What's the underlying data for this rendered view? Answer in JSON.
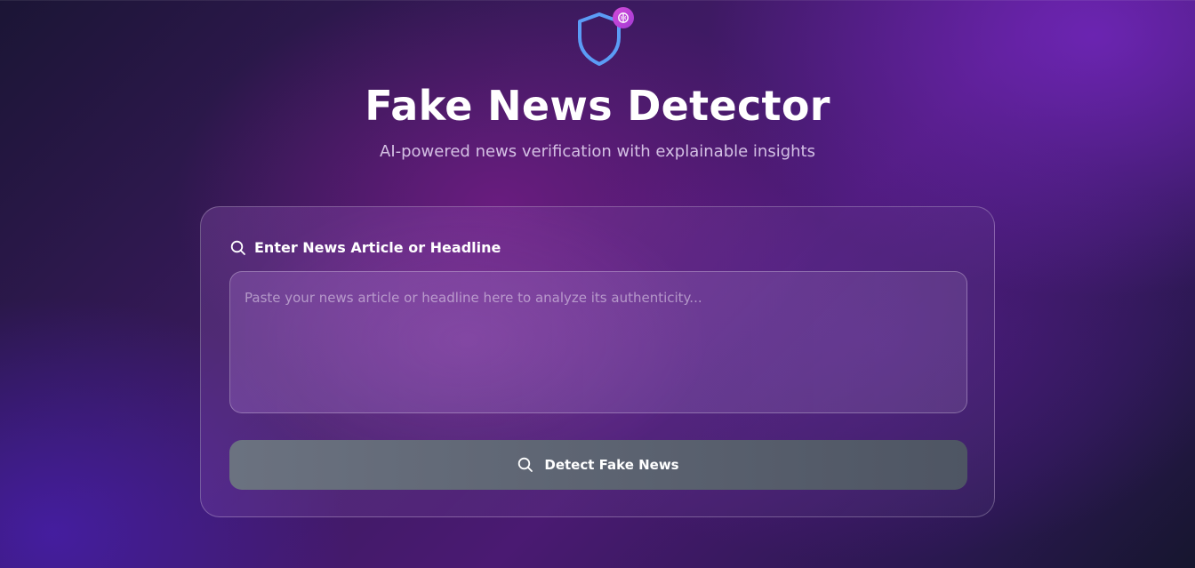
{
  "header": {
    "logo_icon": "shield-icon",
    "badge_icon": "brain-icon",
    "title": "Fake News Detector",
    "subtitle": "AI-powered news verification with explainable insights"
  },
  "input_card": {
    "label": "Enter News Article or Headline",
    "label_icon": "search-icon",
    "textarea_value": "",
    "textarea_placeholder": "Paste your news article or headline here to analyze its authenticity...",
    "button_label": "Detect Fake News",
    "button_icon": "search-icon"
  },
  "colors": {
    "shield_stroke": "#5b9cf6",
    "badge": "#c845d8",
    "button": "#5f6672"
  }
}
